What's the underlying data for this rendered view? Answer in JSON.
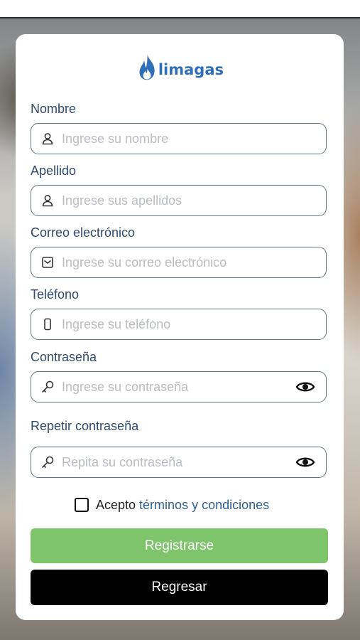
{
  "brand": {
    "name_part1": "lima",
    "name_part2": "gas",
    "color": "#2e6fb7"
  },
  "form": {
    "fields": [
      {
        "label": "Nombre",
        "placeholder": "Ingrese su nombre",
        "icon": "user-icon"
      },
      {
        "label": "Apellido",
        "placeholder": "Ingrese sus apellidos",
        "icon": "user-icon"
      },
      {
        "label": "Correo electrónico",
        "placeholder": "Ingrese su correo electrónico",
        "icon": "email-icon"
      },
      {
        "label": "Teléfono",
        "placeholder": "Ingrese su teléfono",
        "icon": "phone-icon"
      },
      {
        "label": "Contraseña",
        "placeholder": "Ingrese su contraseña",
        "icon": "key-icon",
        "toggle_icon": "eye-icon"
      },
      {
        "label": "Repetir contraseña",
        "placeholder": "Repita su contraseña",
        "icon": "key-icon",
        "toggle_icon": "eye-icon"
      }
    ],
    "terms": {
      "prefix": "Acepto",
      "link": "términos y condiciones",
      "checked": false
    },
    "register_label": "Registrarse",
    "back_label": "Regresar"
  },
  "colors": {
    "register_button": "#7ec46a",
    "back_button": "#000000",
    "label": "#2f4a6d",
    "link": "#2e5f8f"
  }
}
